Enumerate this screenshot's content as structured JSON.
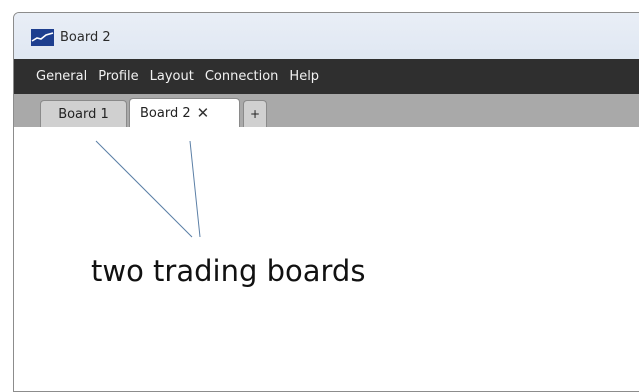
{
  "window": {
    "title": "Board 2",
    "icon": "chart-line-icon",
    "accent_color": "#1e3f8f"
  },
  "menubar": {
    "items": [
      {
        "label": "General"
      },
      {
        "label": "Profile"
      },
      {
        "label": "Layout"
      },
      {
        "label": "Connection"
      },
      {
        "label": "Help"
      }
    ]
  },
  "tabs": {
    "items": [
      {
        "label": "Board 1",
        "active": false
      },
      {
        "label": "Board 2",
        "active": true,
        "close": "✕"
      }
    ],
    "add_label": "+"
  },
  "annotation": {
    "text": "two trading boards",
    "line_color": "#5b7fa6"
  }
}
